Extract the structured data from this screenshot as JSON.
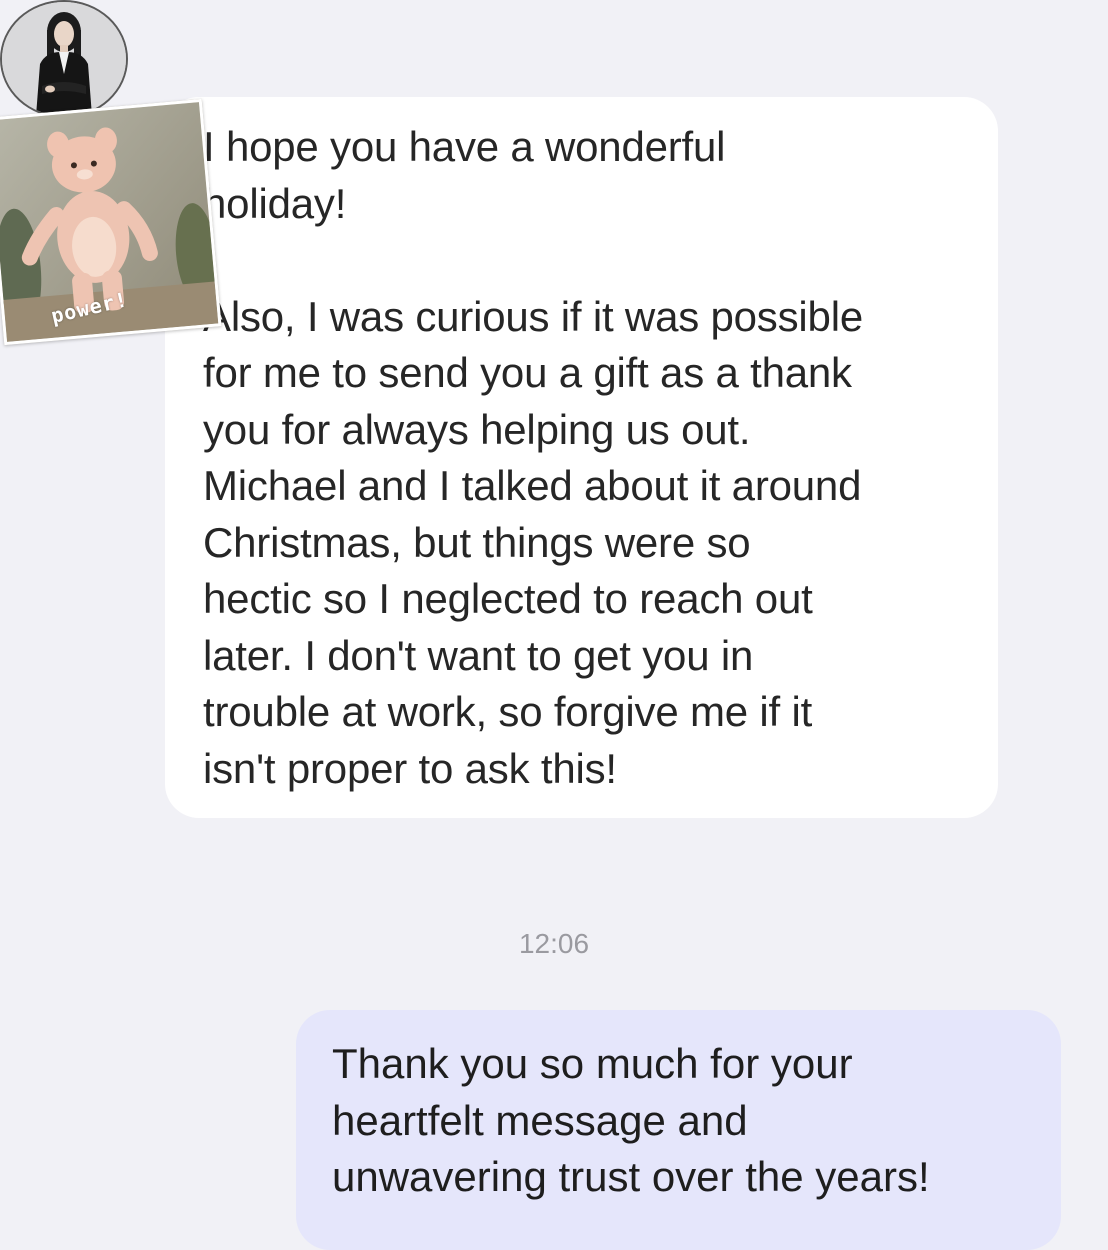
{
  "incoming_message": {
    "text": "I hope you have a wonderful\nholiday!\n\nAlso, I was curious if it was possible\nfor me to send you a gift as a thank\nyou for always helping us out.\nMichael and I talked about it around\nChristmas, but things were so\nhectic so I neglected to reach out\nlater. I don't want to get you in\ntrouble at work, so forgive me if it\nisn't proper to ask this!",
    "sticker_caption": "power!"
  },
  "timestamp": "12:06",
  "outgoing_message": {
    "text": "Thank you so much for your\nheartfelt message and\nunwavering trust over the years!"
  },
  "colors": {
    "background": "#f1f1f6",
    "incoming_bubble": "#ffffff",
    "outgoing_bubble": "#e5e6fb",
    "timestamp": "#9a9aa0"
  }
}
